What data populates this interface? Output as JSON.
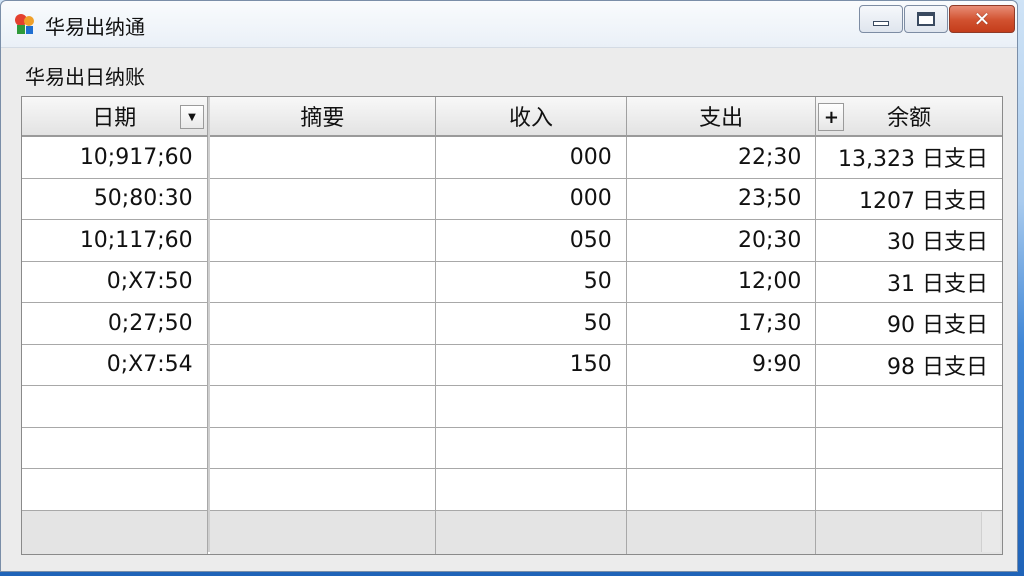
{
  "window": {
    "title": "华易出纳通"
  },
  "section": {
    "title": "华易出日纳账"
  },
  "table": {
    "headers": [
      "日期",
      "摘要",
      "收入",
      "支出",
      "余额"
    ],
    "dropdown_glyph": "▼",
    "plus_glyph": "+",
    "rows": [
      [
        "10;917;60",
        "",
        "000",
        "22;30",
        "13,323 日支日"
      ],
      [
        "50;80:30",
        "",
        "000",
        "23;50",
        "1207 日支日"
      ],
      [
        "10;117;60",
        "",
        "050",
        "20;30",
        "30 日支日"
      ],
      [
        "0;X7:50",
        "",
        "50",
        "12;00",
        "31 日支日"
      ],
      [
        "0;27;50",
        "",
        "50",
        "17;30",
        "90 日支日"
      ],
      [
        "0;X7:54",
        "",
        "150",
        "9:90",
        "98 日支日"
      ],
      [
        "",
        "",
        "",
        "",
        ""
      ],
      [
        "",
        "",
        "",
        "",
        ""
      ],
      [
        "",
        "",
        "",
        "",
        ""
      ]
    ]
  },
  "colors": {
    "accent": "#3f86d6",
    "close": "#c43d1b"
  }
}
